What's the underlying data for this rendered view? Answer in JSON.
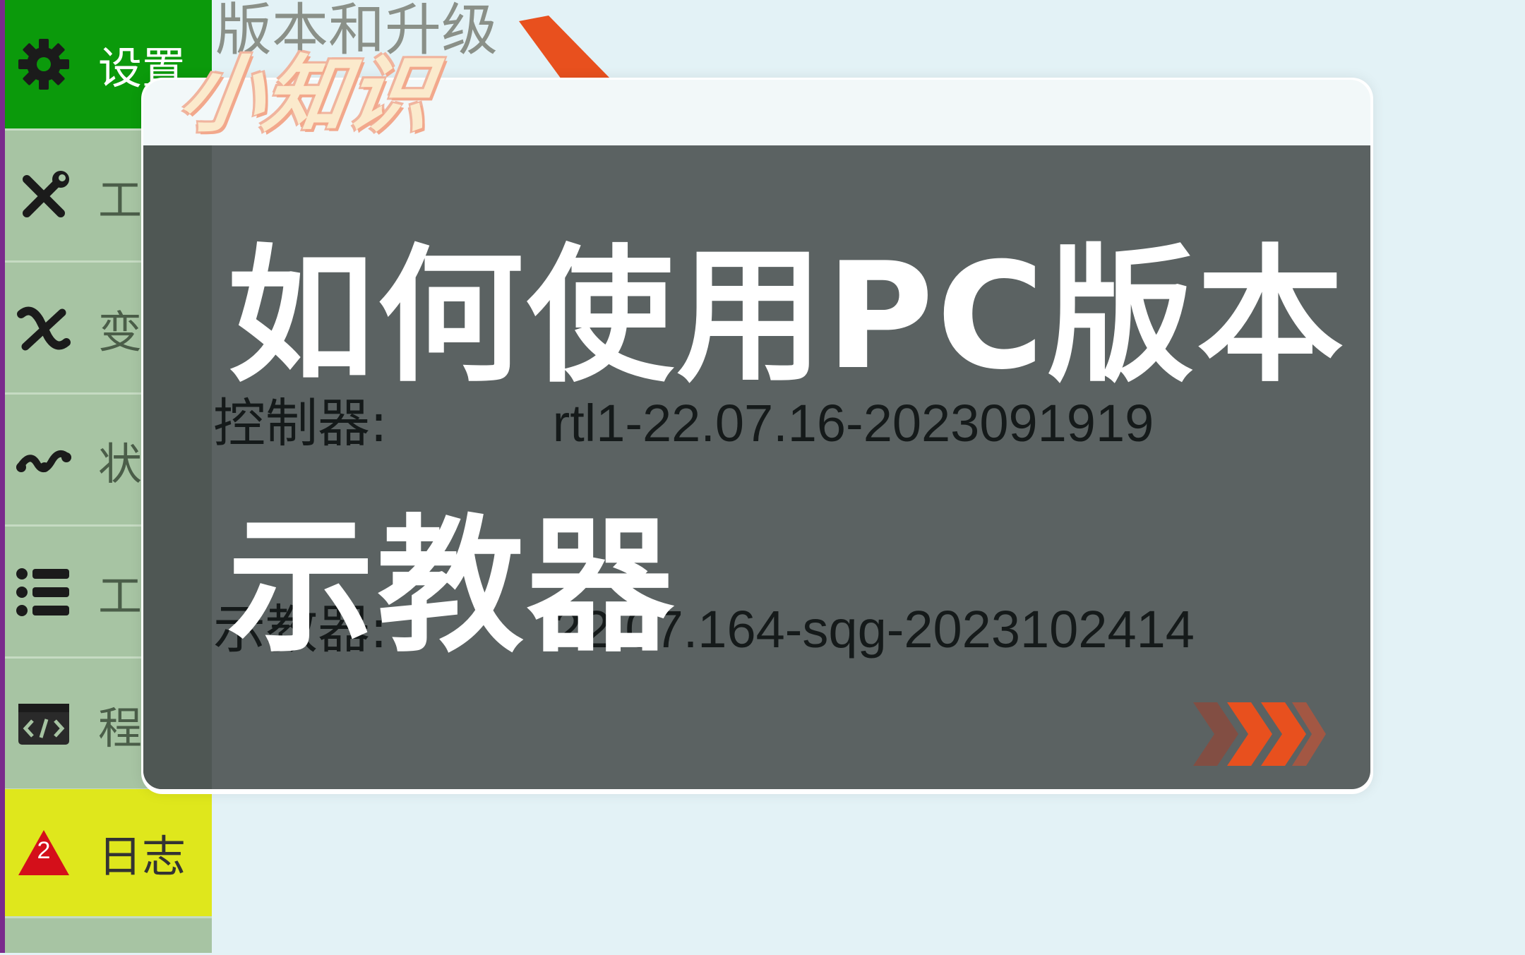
{
  "background": {
    "heading": "版本和升级"
  },
  "sidebar": {
    "items": [
      {
        "label": "设置",
        "icon": "gear-icon",
        "state": "active"
      },
      {
        "label": "工艺",
        "icon": "wrench-screwdriver-icon"
      },
      {
        "label": "变量",
        "icon": "variable-x-icon"
      },
      {
        "label": "状态",
        "icon": "wave-icon"
      },
      {
        "label": "工程",
        "icon": "list-icon"
      },
      {
        "label": "程序",
        "icon": "code-window-icon"
      },
      {
        "label": "日志",
        "icon": "warning-triangle-icon",
        "badge": "2",
        "state": "alert"
      }
    ]
  },
  "dialog": {
    "rows": [
      {
        "label": "控制器:",
        "value": "rtl1-22.07.16-2023091919"
      },
      {
        "label": "示教器:",
        "value": "22.07.164-sqg-2023102414"
      }
    ]
  },
  "overlay": {
    "sticker": "小知识",
    "title_line1": "如何使用PC版本",
    "title_line2": "示教器"
  },
  "colors": {
    "active": "#0b9a0b",
    "log": "#dfe71c",
    "accent": "#e8501e",
    "dialog_body": "#5b6262"
  }
}
